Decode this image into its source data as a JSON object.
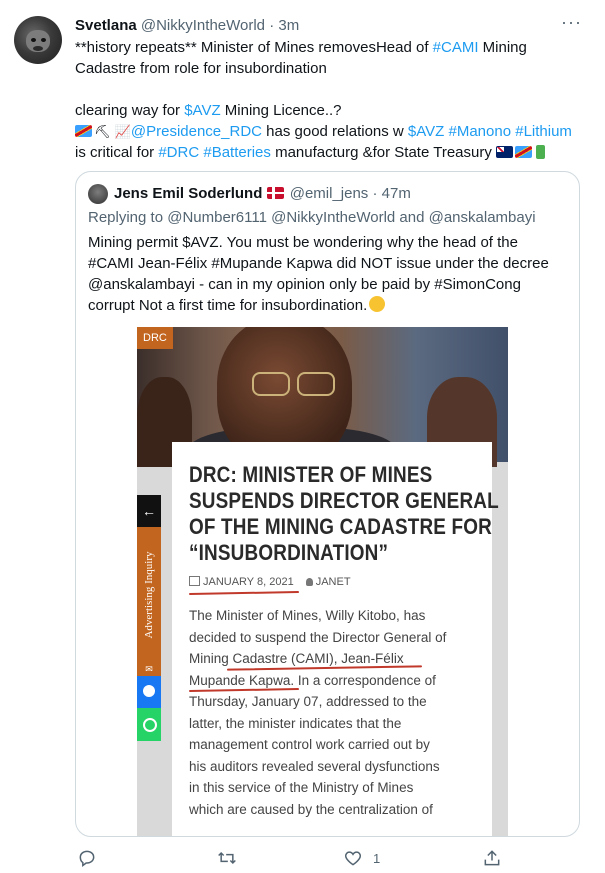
{
  "tweet": {
    "author_name": "Svetlana",
    "handle": "@NikkyIntheWorld",
    "time": "3m",
    "line1": "**history repeats** Minister of Mines removesHead of ",
    "line1_tag": "#CAMI",
    "line1_end": " Mining",
    "line2": "Cadastre from role for insubordination",
    "line3_pre": "clearing way for ",
    "line3_tag": "$AVZ",
    "line3_post": " Mining Licence..?",
    "line4_mention": "@Presidence_RDC",
    "line4_mid": " has good relations w ",
    "line4_tag1": "$AVZ",
    "line4_tag2": "#Manono",
    "line4_tag3": "#Lithium",
    "line5_pre": "is critical for ",
    "line5_tag1": "#DRC",
    "line5_tag2": "#Batteries",
    "line5_post": " manufacturg &for State Treasury"
  },
  "quote": {
    "author_name": "Jens Emil Soderlund",
    "handle": "@emil_jens",
    "time": "47m",
    "replying": "Replying to @Number6111 @NikkyIntheWorld and @anskalambayi",
    "lines": [
      "Mining permit $AVZ. You must be wondering why the head of the",
      "#CAMI Jean-Félix #Mupande Kapwa did NOT issue under the decree",
      "@anskalambayi - can in my opinion only be paid by #SimonCong",
      "corrupt  Not a first time for insubordination."
    ]
  },
  "article": {
    "tag": "DRC",
    "headline": [
      "DRC: MINISTER OF MINES",
      "SUSPENDS DIRECTOR GENERAL",
      "OF THE MINING CADASTRE FOR",
      "“INSUBORDINATION”"
    ],
    "date": "JANUARY 8, 2021",
    "author": "JANET",
    "body": [
      "The Minister of Mines, Willy Kitobo, has",
      "decided to suspend the Director General of",
      "Mining Cadastre (CAMI), Jean-Félix",
      "Mupande Kapwa. In a correspondence of",
      "Thursday, January 07, addressed to the",
      "latter, the minister indicates that the",
      "management control work carried out by",
      "his auditors revealed several dysfunctions",
      "in this service of the Ministry of Mines",
      "which are caused by the centralization of"
    ],
    "sidebar_arrow": "←",
    "sidebar_label": "Advertising Inquiry",
    "sidebar_mail": "✉"
  },
  "actions": {
    "like_count": "1"
  },
  "icons": {
    "more": "more-icon",
    "reply": "reply-icon",
    "retweet": "retweet-icon",
    "like": "heart-icon",
    "share": "share-icon"
  }
}
